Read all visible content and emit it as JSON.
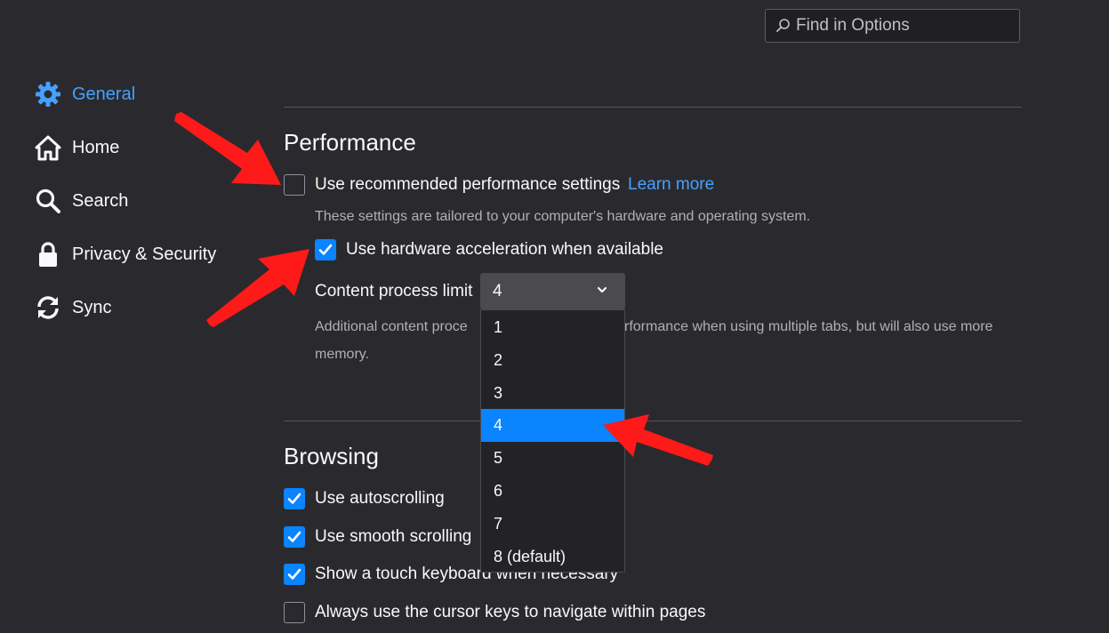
{
  "search": {
    "placeholder": "Find in Options",
    "value": ""
  },
  "sidebar": {
    "items": [
      {
        "label": "General",
        "icon": "gear-icon",
        "active": true
      },
      {
        "label": "Home",
        "icon": "home-icon"
      },
      {
        "label": "Search",
        "icon": "search-icon"
      },
      {
        "label": "Privacy & Security",
        "icon": "lock-icon"
      },
      {
        "label": "Sync",
        "icon": "sync-icon"
      }
    ]
  },
  "performance": {
    "title": "Performance",
    "recommended": {
      "label": "Use recommended performance settings",
      "checked": false
    },
    "learn_more": "Learn more",
    "recommended_desc": "These settings are tailored to your computer's hardware and operating system.",
    "hw_accel": {
      "label": "Use hardware acceleration when available",
      "checked": true
    },
    "content_limit": {
      "label": "Content process limit",
      "selected": "4",
      "options": [
        "1",
        "2",
        "3",
        "4",
        "5",
        "6",
        "7",
        "8 (default)"
      ],
      "desc_left": "Additional content proce",
      "desc_right": "rformance when using multiple tabs, but will also use more",
      "desc_line2": "memory."
    }
  },
  "browsing": {
    "title": "Browsing",
    "options": [
      {
        "label": "Use autoscrolling",
        "checked": true
      },
      {
        "label": "Use smooth scrolling",
        "checked": true
      },
      {
        "label": "Show a touch keyboard when necessary",
        "checked": true
      },
      {
        "label": "Always use the cursor keys to navigate within pages",
        "checked": false
      }
    ]
  },
  "colors": {
    "accent": "#0a84ff",
    "link": "#45a1ff",
    "background": "#2a2a2e",
    "annotation_arrow": "#ff1a1a"
  }
}
